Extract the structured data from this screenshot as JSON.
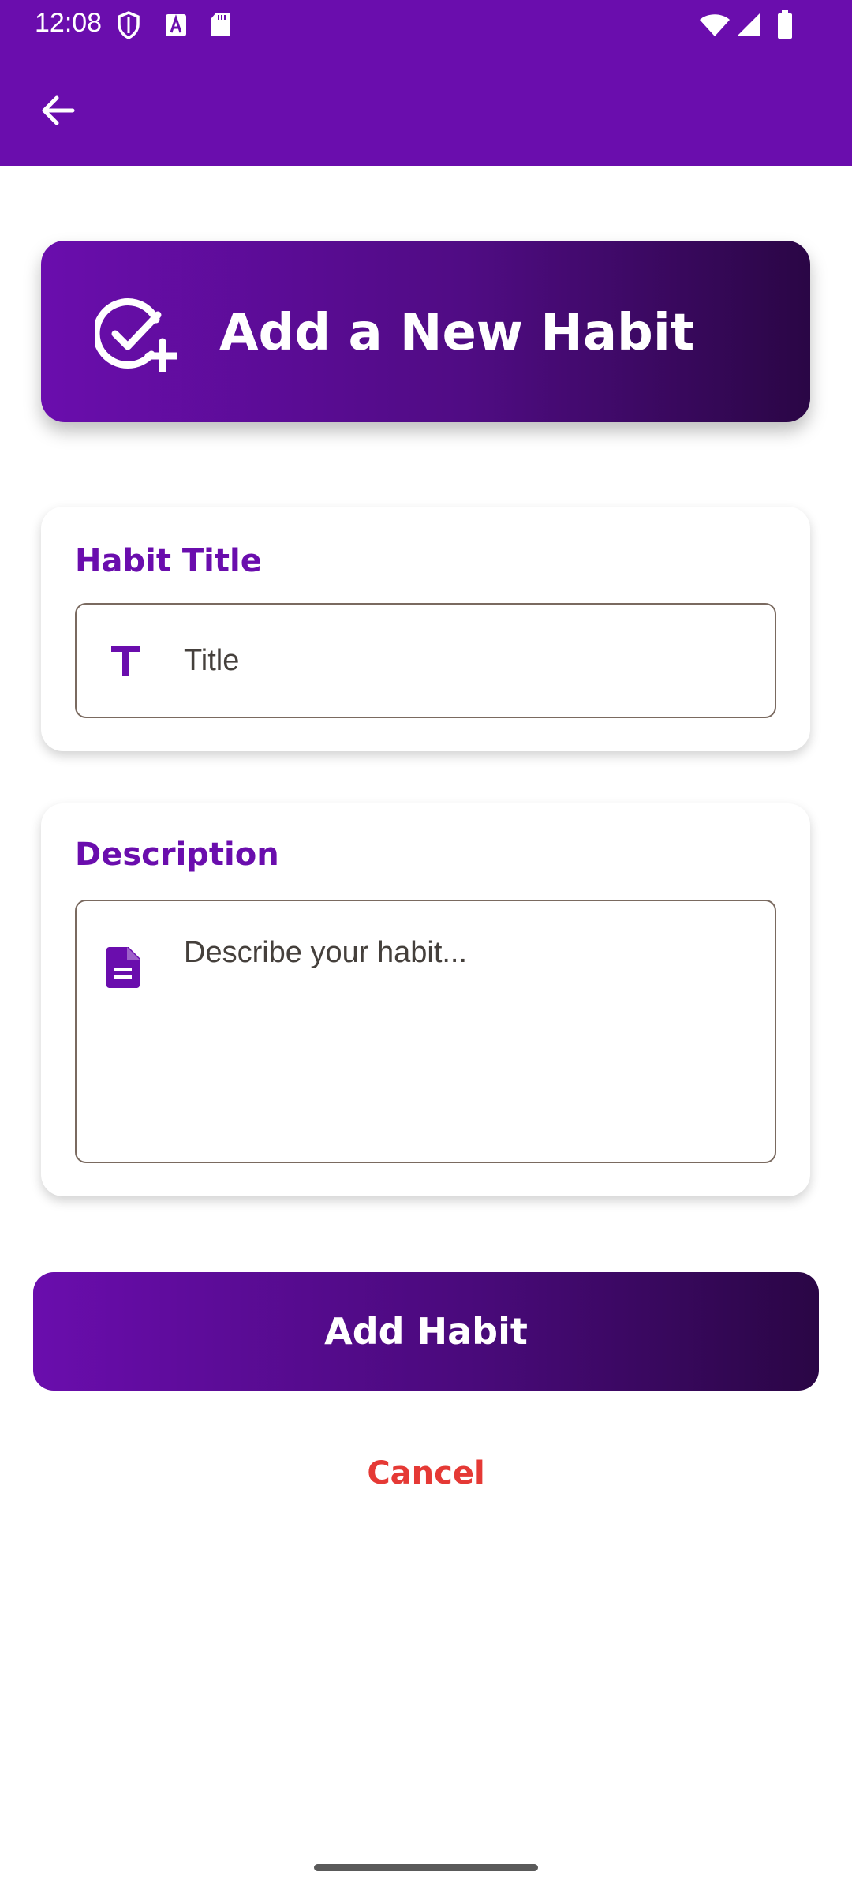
{
  "statusbar": {
    "time": "12:08",
    "icons": [
      "shield-icon",
      "a-box-icon",
      "sd-card-icon",
      "wifi-icon",
      "signal-icon",
      "battery-icon"
    ]
  },
  "appbar": {
    "back_icon": "arrow-back-icon",
    "color": "#6a0dad"
  },
  "header": {
    "icon": "check-circle-plus-icon",
    "title": "Add a New Habit"
  },
  "title_card": {
    "label": "Habit Title",
    "icon": "text-t-icon",
    "placeholder": "Title"
  },
  "description_card": {
    "label": "Description",
    "icon": "document-icon",
    "placeholder": "Describe your habit..."
  },
  "actions": {
    "add_label": "Add Habit",
    "cancel_label": "Cancel"
  },
  "colors": {
    "primary": "#6a0dad",
    "gradient_end": "#2a0645",
    "cancel": "#e53935"
  }
}
